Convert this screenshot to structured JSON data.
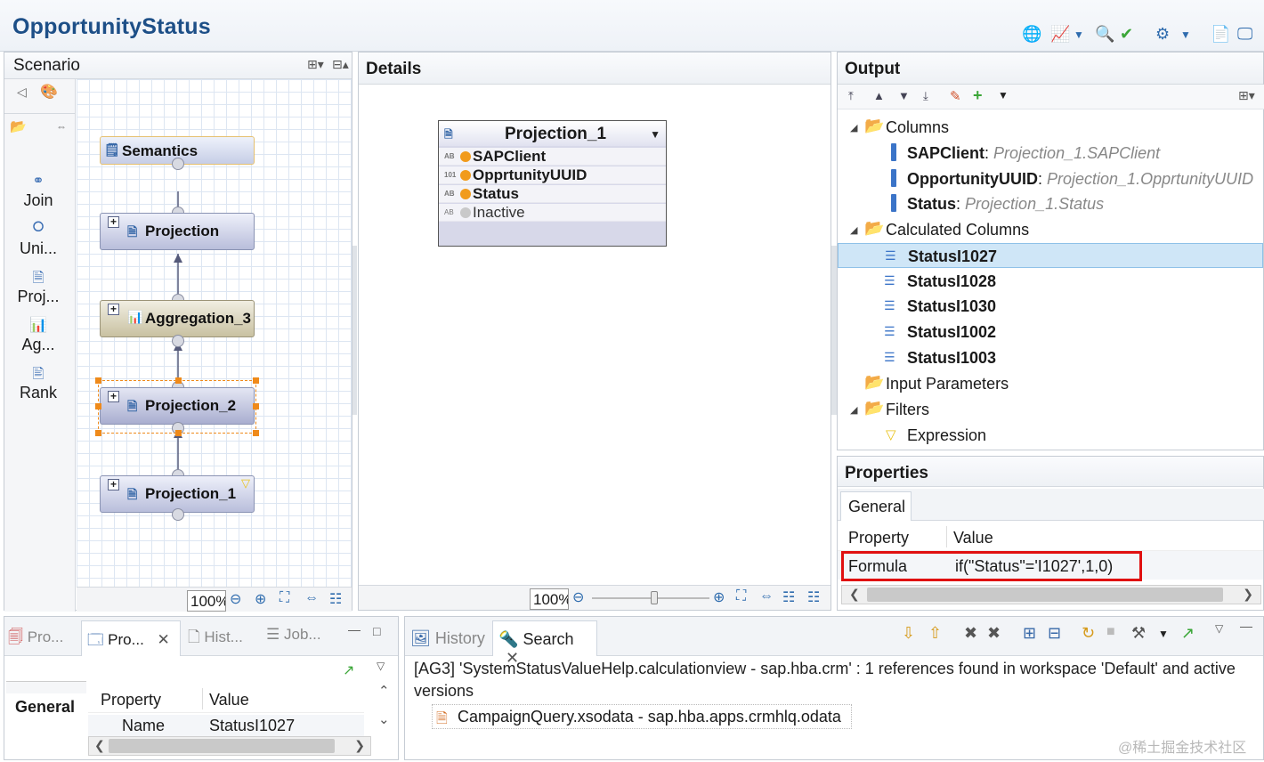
{
  "editor": {
    "title": "OpportunityStatus"
  },
  "scenario": {
    "header": "Scenario",
    "palette": [
      "Join",
      "Uni...",
      "Proj...",
      "Ag...",
      "Rank"
    ],
    "nodes": {
      "semantics": "Semantics",
      "projection": "Projection",
      "aggregation3": "Aggregation_3",
      "projection2": "Projection_2",
      "projection1": "Projection_1"
    },
    "zoom": "100%"
  },
  "details": {
    "header": "Details",
    "box_title": "Projection_1",
    "fields": [
      {
        "label": "SAPClient",
        "status": "mapped"
      },
      {
        "label": "OpprtunityUUID",
        "status": "mapped"
      },
      {
        "label": "Status",
        "status": "mapped"
      },
      {
        "label": "Inactive",
        "status": "unmapped"
      }
    ],
    "zoom": "100%"
  },
  "output": {
    "header": "Output",
    "columns_label": "Columns",
    "columns": [
      {
        "name": "SAPClient",
        "source": "Projection_1.SAPClient"
      },
      {
        "name": "OpportunityUUID",
        "source": "Projection_1.OpprtunityUUID"
      },
      {
        "name": "Status",
        "source": "Projection_1.Status"
      }
    ],
    "calc_label": "Calculated Columns",
    "calc_columns": [
      "StatusI1027",
      "StatusI1028",
      "StatusI1030",
      "StatusI1002",
      "StatusI1003"
    ],
    "input_params_label": "Input Parameters",
    "filters_label": "Filters",
    "expression_label": "Expression"
  },
  "properties": {
    "header": "Properties",
    "tab": "General",
    "col_property": "Property",
    "col_value": "Value",
    "row_property": "Formula",
    "row_value": "if(\"Status\"='I1027',1,0)"
  },
  "bottom_left": {
    "tabs": [
      "Pro...",
      "Pro...",
      "Hist...",
      "Job..."
    ],
    "section": "General",
    "col_property": "Property",
    "col_value": "Value",
    "row_property": "Name",
    "row_value": "StatusI1027"
  },
  "bottom_right": {
    "tabs": [
      "History",
      "Search"
    ],
    "message": "[AG3] 'SystemStatusValueHelp.calculationview - sap.hba.crm' : 1 references found in workspace 'Default' and active versions",
    "result": "CampaignQuery.xsodata - sap.hba.apps.crmhlq.odata"
  },
  "watermark": "@稀土掘金技术社区",
  "colors": {
    "title": "#1d4f87",
    "selection": "#cfe6f7",
    "highlight_box": "#e01010"
  }
}
